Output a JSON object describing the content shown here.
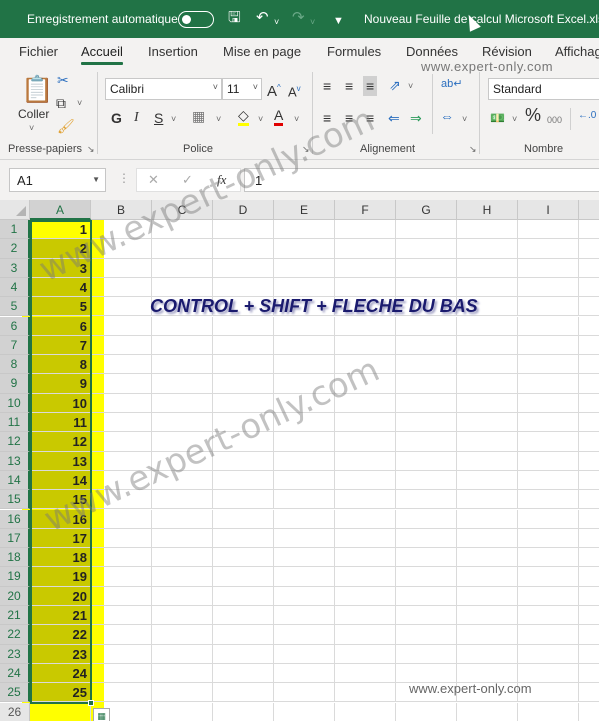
{
  "titlebar": {
    "autosave_label": "Enregistrement automatique",
    "autosave_on": false,
    "document_title": "Nouveau Feuille de calcul Microsoft Excel.xlsx",
    "icons": [
      "save-icon",
      "undo-icon",
      "redo-icon",
      "customize-qat-icon"
    ]
  },
  "tabs": [
    {
      "label": "Fichier",
      "active": false
    },
    {
      "label": "Accueil",
      "active": true
    },
    {
      "label": "Insertion",
      "active": false
    },
    {
      "label": "Mise en page",
      "active": false
    },
    {
      "label": "Formules",
      "active": false
    },
    {
      "label": "Données",
      "active": false
    },
    {
      "label": "Révision",
      "active": false
    },
    {
      "label": "Affichage",
      "active": false
    }
  ],
  "ribbon": {
    "clipboard": {
      "paste_label": "Coller",
      "group_label": "Presse-papiers"
    },
    "font": {
      "font_name": "Calibri",
      "font_size": "11",
      "bold": "G",
      "italic": "I",
      "underline": "S",
      "group_label": "Police",
      "fill_color": "#ffff00",
      "font_color": "#e00000"
    },
    "alignment": {
      "group_label": "Alignement"
    },
    "number": {
      "format": "Standard",
      "percent": "%",
      "thousands": "000",
      "group_label": "Nombre"
    }
  },
  "formula_bar": {
    "name_box": "A1",
    "fx": "fx",
    "value": "1"
  },
  "sheet": {
    "columns": [
      "A",
      "B",
      "C",
      "D",
      "E",
      "F",
      "G",
      "H",
      "I"
    ],
    "selected_column": "A",
    "rows": [
      1,
      2,
      3,
      4,
      5,
      6,
      7,
      8,
      9,
      10,
      11,
      12,
      13,
      14,
      15,
      16,
      17,
      18,
      19,
      20,
      21,
      22,
      23,
      24,
      25,
      26
    ],
    "column_a_values": [
      "1",
      "2",
      "3",
      "4",
      "5",
      "6",
      "7",
      "8",
      "9",
      "10",
      "11",
      "12",
      "13",
      "14",
      "15",
      "16",
      "17",
      "18",
      "19",
      "20",
      "21",
      "22",
      "23",
      "24",
      "25",
      ""
    ],
    "selection": "A1:A25",
    "active_cell": "A1"
  },
  "annotation": "CONTROL + SHIFT + FLECHE DU BAS",
  "watermarks": {
    "text": "www.expert-only.com"
  }
}
